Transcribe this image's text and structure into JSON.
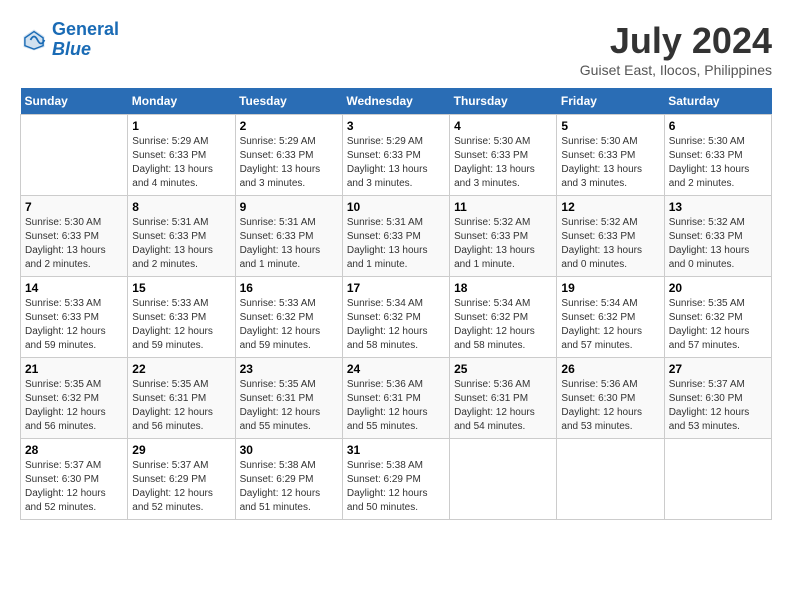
{
  "header": {
    "logo_line1": "General",
    "logo_line2": "Blue",
    "month_title": "July 2024",
    "location": "Guiset East, Ilocos, Philippines"
  },
  "days_of_week": [
    "Sunday",
    "Monday",
    "Tuesday",
    "Wednesday",
    "Thursday",
    "Friday",
    "Saturday"
  ],
  "weeks": [
    [
      {
        "day": "",
        "info": ""
      },
      {
        "day": "1",
        "info": "Sunrise: 5:29 AM\nSunset: 6:33 PM\nDaylight: 13 hours\nand 4 minutes."
      },
      {
        "day": "2",
        "info": "Sunrise: 5:29 AM\nSunset: 6:33 PM\nDaylight: 13 hours\nand 3 minutes."
      },
      {
        "day": "3",
        "info": "Sunrise: 5:29 AM\nSunset: 6:33 PM\nDaylight: 13 hours\nand 3 minutes."
      },
      {
        "day": "4",
        "info": "Sunrise: 5:30 AM\nSunset: 6:33 PM\nDaylight: 13 hours\nand 3 minutes."
      },
      {
        "day": "5",
        "info": "Sunrise: 5:30 AM\nSunset: 6:33 PM\nDaylight: 13 hours\nand 3 minutes."
      },
      {
        "day": "6",
        "info": "Sunrise: 5:30 AM\nSunset: 6:33 PM\nDaylight: 13 hours\nand 2 minutes."
      }
    ],
    [
      {
        "day": "7",
        "info": "Sunrise: 5:30 AM\nSunset: 6:33 PM\nDaylight: 13 hours\nand 2 minutes."
      },
      {
        "day": "8",
        "info": "Sunrise: 5:31 AM\nSunset: 6:33 PM\nDaylight: 13 hours\nand 2 minutes."
      },
      {
        "day": "9",
        "info": "Sunrise: 5:31 AM\nSunset: 6:33 PM\nDaylight: 13 hours\nand 1 minute."
      },
      {
        "day": "10",
        "info": "Sunrise: 5:31 AM\nSunset: 6:33 PM\nDaylight: 13 hours\nand 1 minute."
      },
      {
        "day": "11",
        "info": "Sunrise: 5:32 AM\nSunset: 6:33 PM\nDaylight: 13 hours\nand 1 minute."
      },
      {
        "day": "12",
        "info": "Sunrise: 5:32 AM\nSunset: 6:33 PM\nDaylight: 13 hours\nand 0 minutes."
      },
      {
        "day": "13",
        "info": "Sunrise: 5:32 AM\nSunset: 6:33 PM\nDaylight: 13 hours\nand 0 minutes."
      }
    ],
    [
      {
        "day": "14",
        "info": "Sunrise: 5:33 AM\nSunset: 6:33 PM\nDaylight: 12 hours\nand 59 minutes."
      },
      {
        "day": "15",
        "info": "Sunrise: 5:33 AM\nSunset: 6:33 PM\nDaylight: 12 hours\nand 59 minutes."
      },
      {
        "day": "16",
        "info": "Sunrise: 5:33 AM\nSunset: 6:32 PM\nDaylight: 12 hours\nand 59 minutes."
      },
      {
        "day": "17",
        "info": "Sunrise: 5:34 AM\nSunset: 6:32 PM\nDaylight: 12 hours\nand 58 minutes."
      },
      {
        "day": "18",
        "info": "Sunrise: 5:34 AM\nSunset: 6:32 PM\nDaylight: 12 hours\nand 58 minutes."
      },
      {
        "day": "19",
        "info": "Sunrise: 5:34 AM\nSunset: 6:32 PM\nDaylight: 12 hours\nand 57 minutes."
      },
      {
        "day": "20",
        "info": "Sunrise: 5:35 AM\nSunset: 6:32 PM\nDaylight: 12 hours\nand 57 minutes."
      }
    ],
    [
      {
        "day": "21",
        "info": "Sunrise: 5:35 AM\nSunset: 6:32 PM\nDaylight: 12 hours\nand 56 minutes."
      },
      {
        "day": "22",
        "info": "Sunrise: 5:35 AM\nSunset: 6:31 PM\nDaylight: 12 hours\nand 56 minutes."
      },
      {
        "day": "23",
        "info": "Sunrise: 5:35 AM\nSunset: 6:31 PM\nDaylight: 12 hours\nand 55 minutes."
      },
      {
        "day": "24",
        "info": "Sunrise: 5:36 AM\nSunset: 6:31 PM\nDaylight: 12 hours\nand 55 minutes."
      },
      {
        "day": "25",
        "info": "Sunrise: 5:36 AM\nSunset: 6:31 PM\nDaylight: 12 hours\nand 54 minutes."
      },
      {
        "day": "26",
        "info": "Sunrise: 5:36 AM\nSunset: 6:30 PM\nDaylight: 12 hours\nand 53 minutes."
      },
      {
        "day": "27",
        "info": "Sunrise: 5:37 AM\nSunset: 6:30 PM\nDaylight: 12 hours\nand 53 minutes."
      }
    ],
    [
      {
        "day": "28",
        "info": "Sunrise: 5:37 AM\nSunset: 6:30 PM\nDaylight: 12 hours\nand 52 minutes."
      },
      {
        "day": "29",
        "info": "Sunrise: 5:37 AM\nSunset: 6:29 PM\nDaylight: 12 hours\nand 52 minutes."
      },
      {
        "day": "30",
        "info": "Sunrise: 5:38 AM\nSunset: 6:29 PM\nDaylight: 12 hours\nand 51 minutes."
      },
      {
        "day": "31",
        "info": "Sunrise: 5:38 AM\nSunset: 6:29 PM\nDaylight: 12 hours\nand 50 minutes."
      },
      {
        "day": "",
        "info": ""
      },
      {
        "day": "",
        "info": ""
      },
      {
        "day": "",
        "info": ""
      }
    ]
  ]
}
